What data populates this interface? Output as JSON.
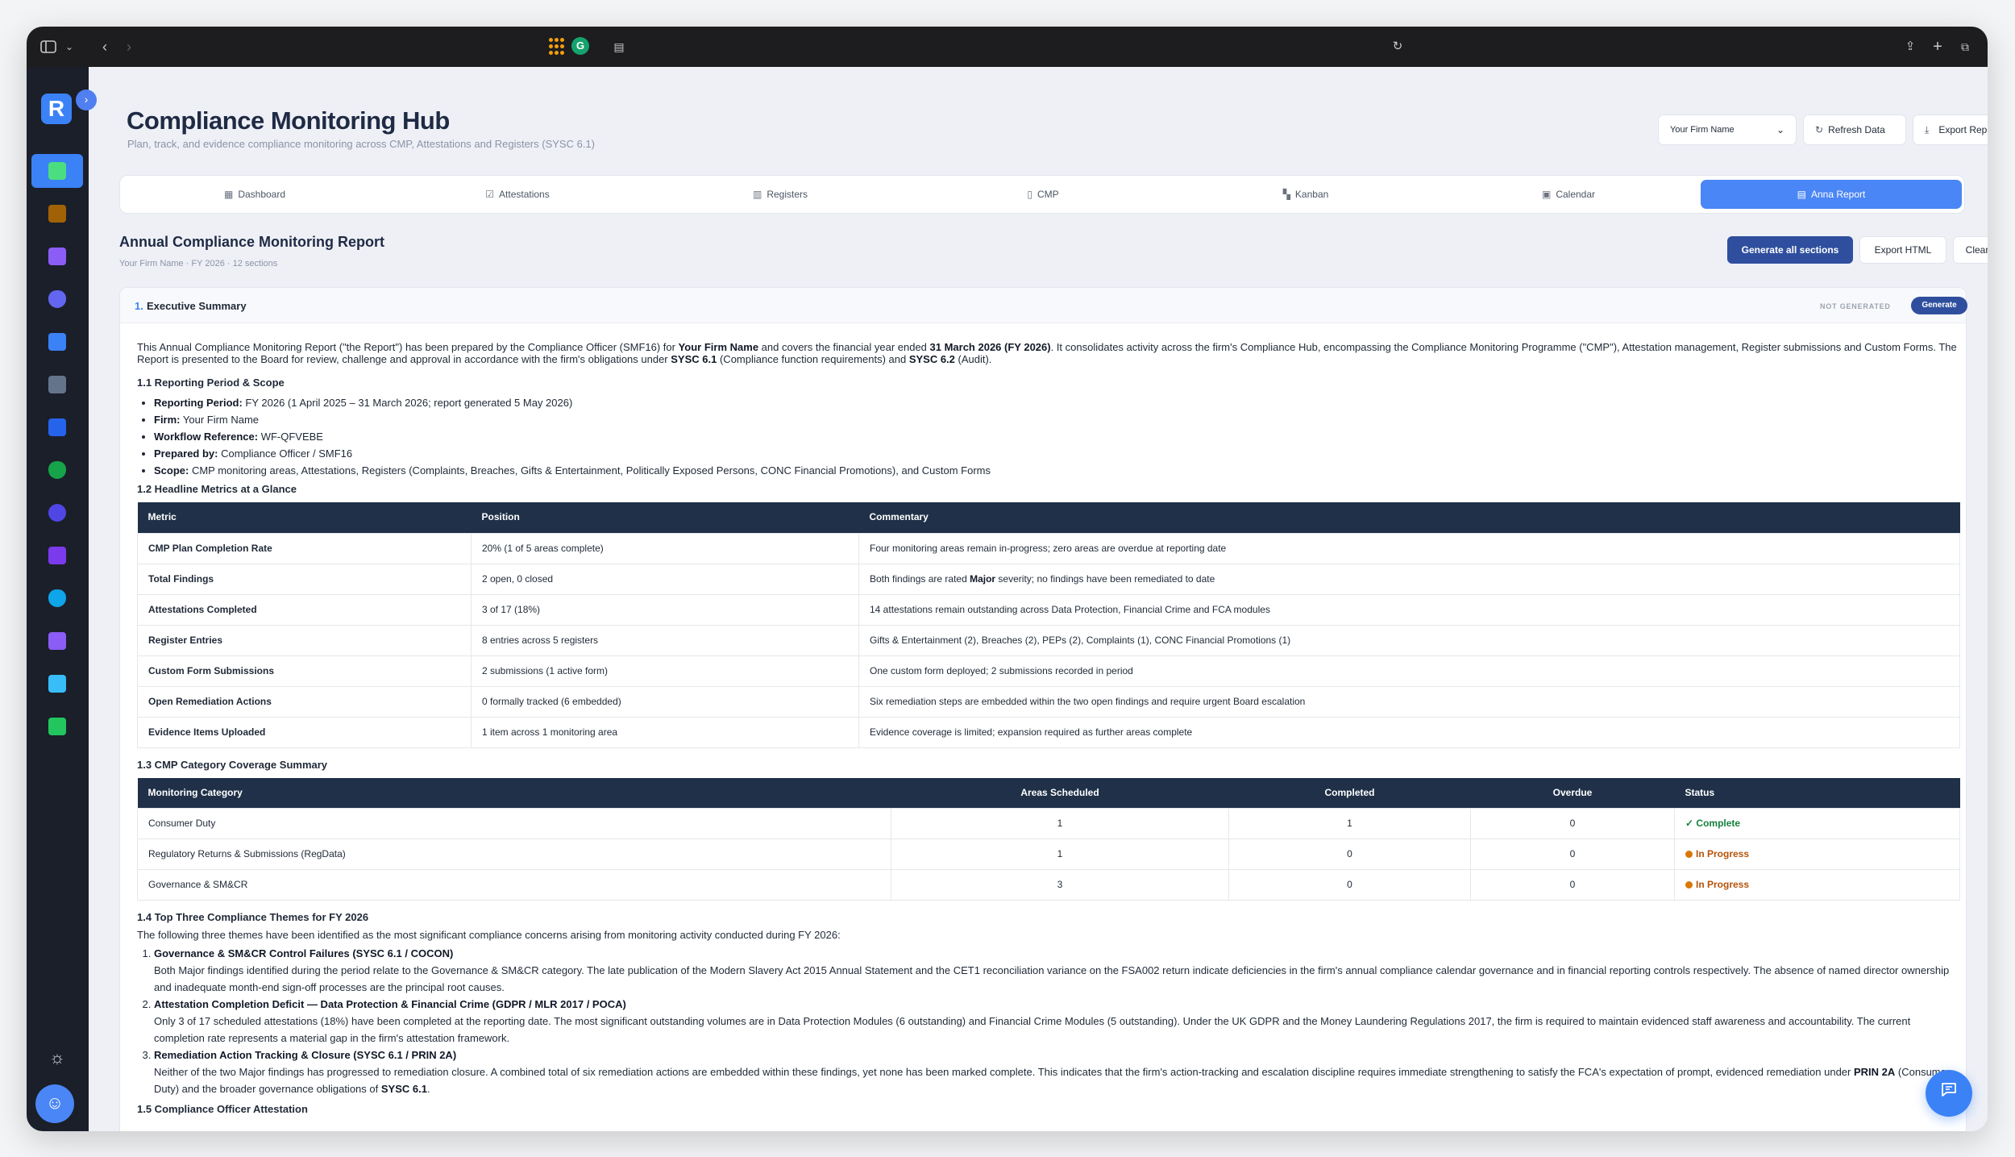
{
  "colors": {
    "accent": "#4a86f5",
    "primary_dark": "#2f4f9e",
    "table_header": "#1f3048",
    "sidebar": "#1b1f2a",
    "complete": "#15803d",
    "in_progress": "#b45309"
  },
  "header": {
    "title": "Compliance Monitoring Hub",
    "subtitle": "Plan, track, and evidence compliance monitoring across CMP, Attestations and Registers (SYSC 6.1)",
    "firm_select_value": "Your Firm Name",
    "refresh_label": "Refresh Data",
    "export_label": "Export Report"
  },
  "tabs": [
    {
      "label": "Dashboard",
      "icon": "grid-icon"
    },
    {
      "label": "Attestations",
      "icon": "checkbox-icon"
    },
    {
      "label": "Registers",
      "icon": "book-icon"
    },
    {
      "label": "CMP",
      "icon": "file-icon"
    },
    {
      "label": "Kanban",
      "icon": "kanban-icon"
    },
    {
      "label": "Calendar",
      "icon": "calendar-icon"
    },
    {
      "label": "Anna Report",
      "icon": "document-icon",
      "active": true
    }
  ],
  "report": {
    "title": "Annual Compliance Monitoring Report",
    "meta": "Your Firm Name · FY 2026 · 12 sections",
    "generate_all_label": "Generate all sections",
    "export_html_label": "Export HTML",
    "clear_label": "Clear"
  },
  "section": {
    "number": "1.",
    "title": "Executive Summary",
    "status": "NOT GENERATED",
    "generate_label": "Generate"
  },
  "intro": {
    "p1": "This Annual Compliance Monitoring Report (\"the Report\") has been prepared by the Compliance Officer (SMF16) for ",
    "firm": "Your Firm Name",
    "p2": " and covers the financial year ended ",
    "fy": "31 March 2026 (FY 2026)",
    "p3": ". It consolidates activity across the firm's Compliance Hub, encompassing the Compliance Monitoring Programme (\"CMP\"), Attestation management, Register submissions and Custom Forms. The Report is presented to the Board for review, challenge and approval in accordance with the firm's obligations under ",
    "sysc61": "SYSC 6.1",
    "p4": " (Compliance function requirements) and ",
    "sysc62": "SYSC 6.2",
    "p5": " (Audit)."
  },
  "reporting_period": {
    "heading": "1.1 Reporting Period & Scope",
    "items": [
      {
        "label": "Reporting Period:",
        "value": " FY 2026 (1 April 2025 – 31 March 2026; report generated 5 May 2026)"
      },
      {
        "label": "Firm:",
        "value": " Your Firm Name"
      },
      {
        "label": "Workflow Reference:",
        "value": " WF-QFVEBE"
      },
      {
        "label": "Prepared by:",
        "value": " Compliance Officer / SMF16"
      },
      {
        "label": "Scope:",
        "value": " CMP monitoring areas, Attestations, Registers (Complaints, Breaches, Gifts & Entertainment, Politically Exposed Persons, CONC Financial Promotions), and Custom Forms"
      }
    ]
  },
  "metrics": {
    "heading": "1.2 Headline Metrics at a Glance",
    "columns": [
      "Metric",
      "Position",
      "Commentary"
    ],
    "rows": [
      {
        "metric": "CMP Plan Completion Rate",
        "position": "20% (1 of 5 areas complete)",
        "commentary": "Four monitoring areas remain in-progress; zero areas are overdue at reporting date"
      },
      {
        "metric": "Total Findings",
        "position": "2 open, 0 closed",
        "c1": "Both findings are rated ",
        "c_bold": "Major",
        "c2": " severity; no findings have been remediated to date"
      },
      {
        "metric": "Attestations Completed",
        "position": "3 of 17 (18%)",
        "commentary": "14 attestations remain outstanding across Data Protection, Financial Crime and FCA modules"
      },
      {
        "metric": "Register Entries",
        "position": "8 entries across 5 registers",
        "commentary": "Gifts & Entertainment (2), Breaches (2), PEPs (2), Complaints (1), CONC Financial Promotions (1)"
      },
      {
        "metric": "Custom Form Submissions",
        "position": "2 submissions (1 active form)",
        "commentary": "One custom form deployed; 2 submissions recorded in period"
      },
      {
        "metric": "Open Remediation Actions",
        "position": "0 formally tracked (6 embedded)",
        "commentary": "Six remediation steps are embedded within the two open findings and require urgent Board escalation"
      },
      {
        "metric": "Evidence Items Uploaded",
        "position": "1 item across 1 monitoring area",
        "commentary": "Evidence coverage is limited; expansion required as further areas complete"
      }
    ]
  },
  "coverage": {
    "heading": "1.3 CMP Category Coverage Summary",
    "columns": [
      "Monitoring Category",
      "Areas Scheduled",
      "Completed",
      "Overdue",
      "Status"
    ],
    "rows": [
      {
        "category": "Consumer Duty",
        "scheduled": "1",
        "completed": "1",
        "overdue": "0",
        "status": "Complete",
        "status_icon": "✓",
        "kind": "ok"
      },
      {
        "category": "Regulatory Returns & Submissions (RegData)",
        "scheduled": "1",
        "completed": "0",
        "overdue": "0",
        "status": "In Progress",
        "kind": "prog"
      },
      {
        "category": "Governance & SM&CR",
        "scheduled": "3",
        "completed": "0",
        "overdue": "0",
        "status": "In Progress",
        "kind": "prog"
      }
    ]
  },
  "themes": {
    "heading": "1.4 Top Three Compliance Themes for FY 2026",
    "intro": "The following three themes have been identified as the most significant compliance concerns arising from monitoring activity conducted during FY 2026:",
    "items": [
      {
        "title": "Governance & SM&CR Control Failures (SYSC 6.1 / COCON)",
        "text": "Both Major findings identified during the period relate to the Governance & SM&CR category. The late publication of the Modern Slavery Act 2015 Annual Statement and the CET1 reconciliation variance on the FSA002 return indicate deficiencies in the firm's annual compliance calendar governance and in financial reporting controls respectively. The absence of named director ownership and inadequate month-end sign-off processes are the principal root causes."
      },
      {
        "title": "Attestation Completion Deficit — Data Protection & Financial Crime (GDPR / MLR 2017 / POCA)",
        "text": "Only 3 of 17 scheduled attestations (18%) have been completed at the reporting date. The most significant outstanding volumes are in Data Protection Modules (6 outstanding) and Financial Crime Modules (5 outstanding). Under the UK GDPR and the Money Laundering Regulations 2017, the firm is required to maintain evidenced staff awareness and accountability. The current completion rate represents a material gap in the firm's attestation framework."
      },
      {
        "title": "Remediation Action Tracking & Closure (SYSC 6.1 / PRIN 2A)",
        "t1": "Neither of the two Major findings has progressed to remediation closure. A combined total of six remediation actions are embedded within these findings, yet none has been marked complete. This indicates that the firm's action-tracking and escalation discipline requires immediate strengthening to satisfy the FCA's expectation of prompt, evidenced remediation under ",
        "b1": "PRIN 2A",
        "t2": " (Consumer Duty) and the broader governance obligations of ",
        "b2": "SYSC 6.1",
        "t3": "."
      }
    ]
  },
  "attestation_heading": "1.5 Compliance Officer Attestation"
}
